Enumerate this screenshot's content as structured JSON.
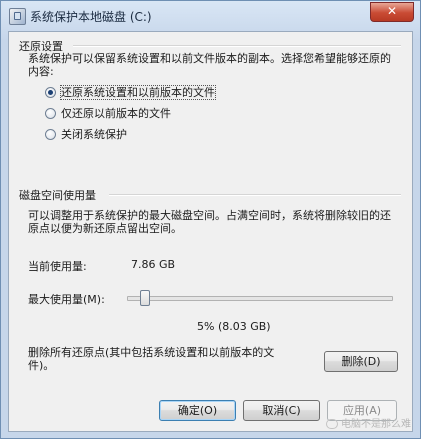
{
  "window": {
    "title": "系统保护本地磁盘 (C:)",
    "close_glyph": "✕"
  },
  "restore": {
    "heading": "还原设置",
    "description": "系统保护可以保留系统设置和以前文件版本的副本。选择您希望能够还原的内容:",
    "options": [
      {
        "label": "还原系统设置和以前版本的文件",
        "checked": true
      },
      {
        "label": "仅还原以前版本的文件",
        "checked": false
      },
      {
        "label": "关闭系统保护",
        "checked": false
      }
    ]
  },
  "disk": {
    "heading": "磁盘空间使用量",
    "description": "可以调整用于系统保护的最大磁盘空间。占满空间时，系统将删除较旧的还原点以便为新还原点留出空间。",
    "current_label": "当前使用量:",
    "current_value": "7.86 GB",
    "max_label": "最大使用量(M):",
    "max_percent": 5,
    "slider_caption": "5% (8.03 GB)"
  },
  "delete": {
    "text": "删除所有还原点(其中包括系统设置和以前版本的文件)。",
    "button": "删除(D)"
  },
  "footer": {
    "ok": "确定(O)",
    "cancel": "取消(C)",
    "apply": "应用(A)"
  },
  "watermark": "电脑不是那么难"
}
